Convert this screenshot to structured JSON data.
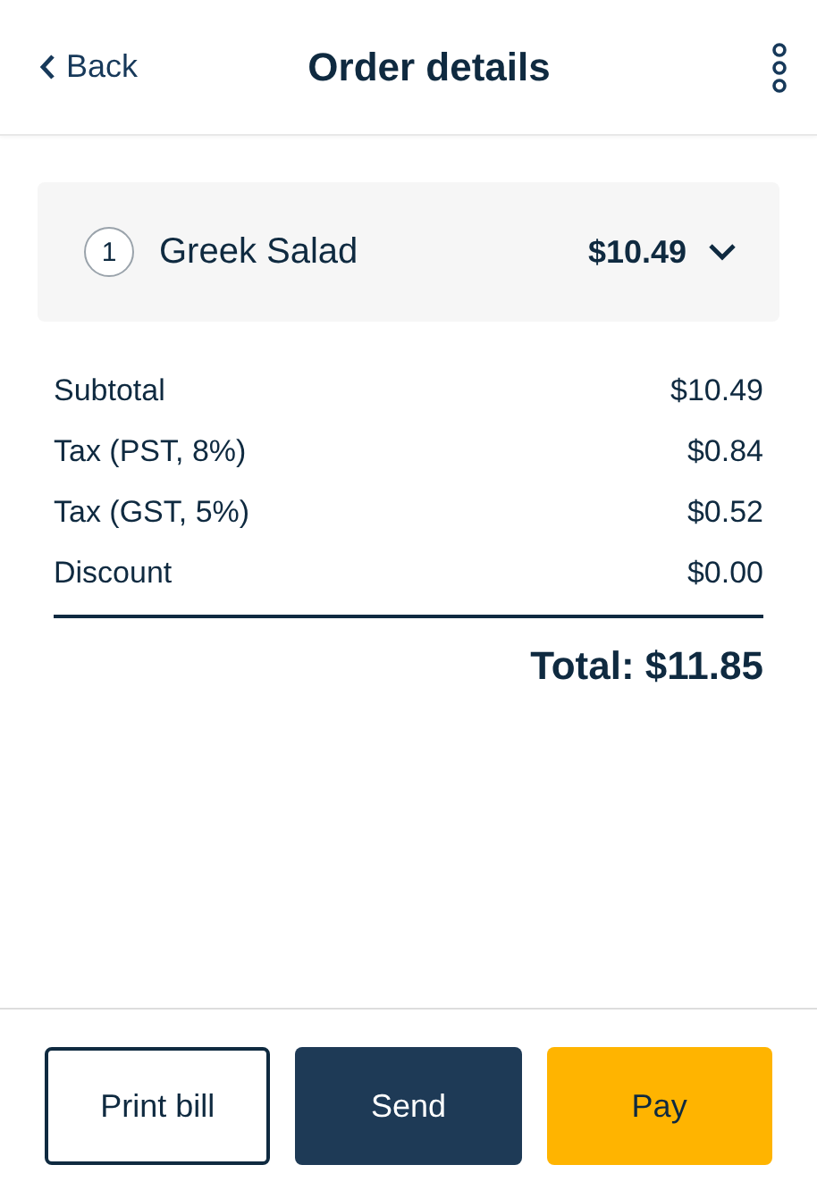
{
  "header": {
    "back": "Back",
    "title": "Order details"
  },
  "items": [
    {
      "quantity": "1",
      "name": "Greek Salad",
      "price": "$10.49",
      "expanded": false
    }
  ],
  "summary": [
    {
      "label": "Subtotal",
      "value": "$10.49"
    },
    {
      "label": "Tax (PST, 8%)",
      "value": "$0.84"
    },
    {
      "label": "Tax (GST, 5%)",
      "value": "$0.52"
    },
    {
      "label": "Discount",
      "value": "$0.00"
    }
  ],
  "total": "Total: $11.85",
  "buttons": [
    {
      "label": "Print bill",
      "kind": "outline"
    },
    {
      "label": "Send",
      "kind": "dark"
    },
    {
      "label": "Pay",
      "kind": "accent"
    }
  ]
}
